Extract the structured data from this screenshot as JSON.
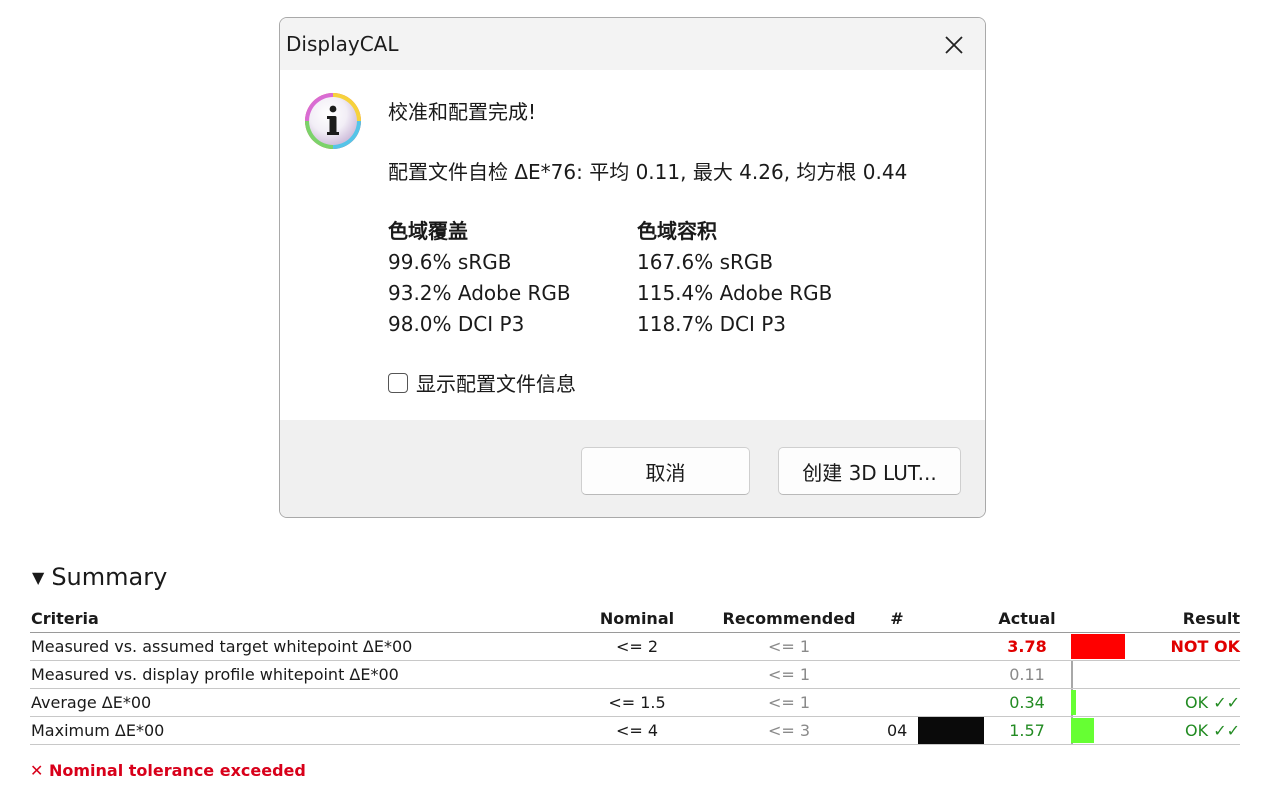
{
  "dialog": {
    "title": "DisplayCAL",
    "headline": "校准和配置完成!",
    "selfcheck": "配置文件自检 ΔE*76: 平均 0.11, 最大 4.26, 均方根 0.44",
    "coverage": {
      "heading": "色域覆盖",
      "items": [
        "99.6% sRGB",
        "93.2% Adobe RGB",
        "98.0% DCI P3"
      ]
    },
    "volume": {
      "heading": "色域容积",
      "items": [
        "167.6% sRGB",
        "115.4% Adobe RGB",
        "118.7% DCI P3"
      ]
    },
    "checkbox_label": "显示配置文件信息",
    "checkbox_checked": false,
    "cancel_label": "取消",
    "lut_label": "创建 3D LUT..."
  },
  "summary": {
    "title": "Summary",
    "columns": {
      "criteria": "Criteria",
      "nominal": "Nominal",
      "recommended": "Recommended",
      "num": "#",
      "actual": "Actual",
      "result": "Result"
    },
    "rows": [
      {
        "criteria": "Measured vs. assumed target whitepoint ΔE*00",
        "nominal": "<= 2",
        "recommended": "<= 1",
        "num": "",
        "actual": "3.78",
        "result": "NOT OK",
        "status": "fail",
        "bar_fraction": 1.0
      },
      {
        "criteria": "Measured vs. display profile whitepoint ΔE*00",
        "nominal": "",
        "recommended": "<= 1",
        "num": "",
        "actual": "0.11",
        "result": "",
        "status": "neutral",
        "bar_fraction": 0.0
      },
      {
        "criteria": "Average ΔE*00",
        "nominal": "<= 1.5",
        "recommended": "<= 1",
        "num": "",
        "actual": "0.34",
        "result": "OK ✓✓",
        "status": "pass",
        "bar_fraction": 0.09
      },
      {
        "criteria": "Maximum ΔE*00",
        "nominal": "<= 4",
        "recommended": "<= 3",
        "num": "04",
        "actual": "1.57",
        "result": "OK ✓✓",
        "status": "pass",
        "bar_fraction": 0.42
      }
    ],
    "tolerance_message": "✕ Nominal tolerance exceeded"
  },
  "colors": {
    "fail": "#ff0000",
    "pass": "#66ff33",
    "swatch": "#0a0a0a"
  }
}
